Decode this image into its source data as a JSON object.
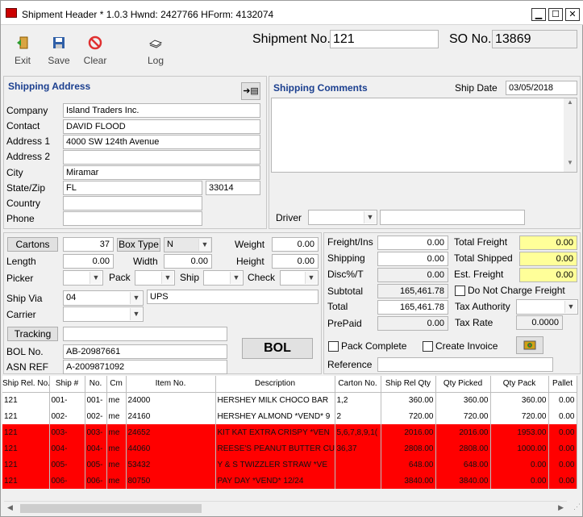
{
  "window": {
    "title": "Shipment Header * 1.0.3 Hwnd: 2427766  HForm: 4132074",
    "buttons": {
      "minimize": "▁",
      "maximize": "☐",
      "close": "✕"
    }
  },
  "toolbar": {
    "exit_label": "Exit",
    "save_label": "Save",
    "clear_label": "Clear",
    "log_label": "Log"
  },
  "header": {
    "shipment_no_label": "Shipment No.",
    "shipment_no": "121",
    "so_no_label": "SO No.",
    "so_no": "13869"
  },
  "shipping_address": {
    "title": "Shipping Address",
    "company_label": "Company",
    "company": "Island Traders Inc.",
    "contact_label": "Contact",
    "contact": "DAVID FLOOD",
    "address1_label": "Address 1",
    "address1": "4000 SW 124th Avenue",
    "address2_label": "Address 2",
    "address2": "",
    "city_label": "City",
    "city": "Miramar",
    "statezip_label": "State/Zip",
    "state": "FL",
    "zip": "33014",
    "country_label": "Country",
    "country": "",
    "phone_label": "Phone",
    "phone": ""
  },
  "shipping_comments": {
    "title": "Shipping Comments",
    "ship_date_label": "Ship Date",
    "ship_date": "03/05/2018",
    "driver_label": "Driver"
  },
  "package": {
    "cartons_label": "Cartons",
    "cartons": "37",
    "box_type_label": "Box Type",
    "box_type": "N",
    "weight_label": "Weight",
    "weight": "0.00",
    "length_label": "Length",
    "length": "0.00",
    "width_label": "Width",
    "width": "0.00",
    "height_label": "Height",
    "height": "0.00",
    "picker_label": "Picker",
    "pack_label": "Pack",
    "ship_label": "Ship",
    "check_label": "Check",
    "ship_via_label": "Ship Via",
    "ship_via": "04",
    "ship_via_desc": "UPS",
    "carrier_label": "Carrier",
    "tracking_label": "Tracking",
    "bol_no_label": "BOL No.",
    "bol_no": "AB-20987661",
    "asn_ref_label": "ASN REF",
    "asn_ref": "A-2009871092",
    "bol_button": "BOL"
  },
  "freight": {
    "freight_ins_label": "Freight/Ins",
    "freight_ins": "0.00",
    "shipping_label": "Shipping",
    "shipping": "0.00",
    "disc_label": "Disc%/T",
    "disc": "0.00",
    "subtotal_label": "Subtotal",
    "subtotal": "165,461.78",
    "total_label": "Total",
    "total": "165,461.78",
    "prepaid_label": "PrePaid",
    "prepaid": "0.00",
    "total_freight_label": "Total Freight",
    "total_freight": "0.00",
    "total_shipped_label": "Total Shipped",
    "total_shipped": "0.00",
    "est_freight_label": "Est. Freight",
    "est_freight": "0.00",
    "no_charge_label": "Do Not Charge Freight",
    "tax_authority_label": "Tax Authority",
    "tax_rate_label": "Tax Rate",
    "tax_rate": "0.0000",
    "pack_complete_label": "Pack Complete",
    "create_invoice_label": "Create Invoice",
    "reference_label": "Reference"
  },
  "grid": {
    "columns": [
      "Ship Rel. No.",
      "Ship #",
      "No.",
      "Cm",
      "Item No.",
      "Description",
      "Carton No.",
      "Ship Rel Qty",
      "Qty Picked",
      "Qty Pack",
      "Pallet"
    ],
    "rows": [
      {
        "style": "white",
        "cells": [
          "121",
          "001-",
          "001-",
          "me",
          "24000",
          "HERSHEY MILK CHOCO BAR",
          "1,2",
          "360.00",
          "360.00",
          "360.00",
          "0.00"
        ]
      },
      {
        "style": "white",
        "cells": [
          "121",
          "002-",
          "002-",
          "me",
          "24160",
          "HERSHEY ALMOND *VEND* 9",
          "2",
          "720.00",
          "720.00",
          "720.00",
          "0.00"
        ]
      },
      {
        "style": "red",
        "cells": [
          "121",
          "003-",
          "003-",
          "me",
          "24652",
          "KIT KAT EXTRA CRISPY *VEN",
          "5,6,7,8,9,1(",
          "2016.00",
          "2016.00",
          "1953.00",
          "0.00"
        ]
      },
      {
        "style": "red",
        "cells": [
          "121",
          "004-",
          "004-",
          "me",
          "44060",
          "REESE'S PEANUT BUTTER CU",
          "36,37",
          "2808.00",
          "2808.00",
          "1000.00",
          "0.00"
        ]
      },
      {
        "style": "red",
        "cells": [
          "121",
          "005-",
          "005-",
          "me",
          "53432",
          "Y & S TWIZZLER STRAW  *VE",
          "",
          "648.00",
          "648.00",
          "0.00",
          "0.00"
        ]
      },
      {
        "style": "red",
        "cells": [
          "121",
          "006-",
          "006-",
          "me",
          "80750",
          "PAY DAY *VEND* 12/24",
          "",
          "3840.00",
          "3840.00",
          "0.00",
          "0.00"
        ]
      }
    ]
  },
  "colors": {
    "red_row": "#ff0000",
    "yellow_field": "#ffff99",
    "section_title": "#1b3f8f"
  }
}
